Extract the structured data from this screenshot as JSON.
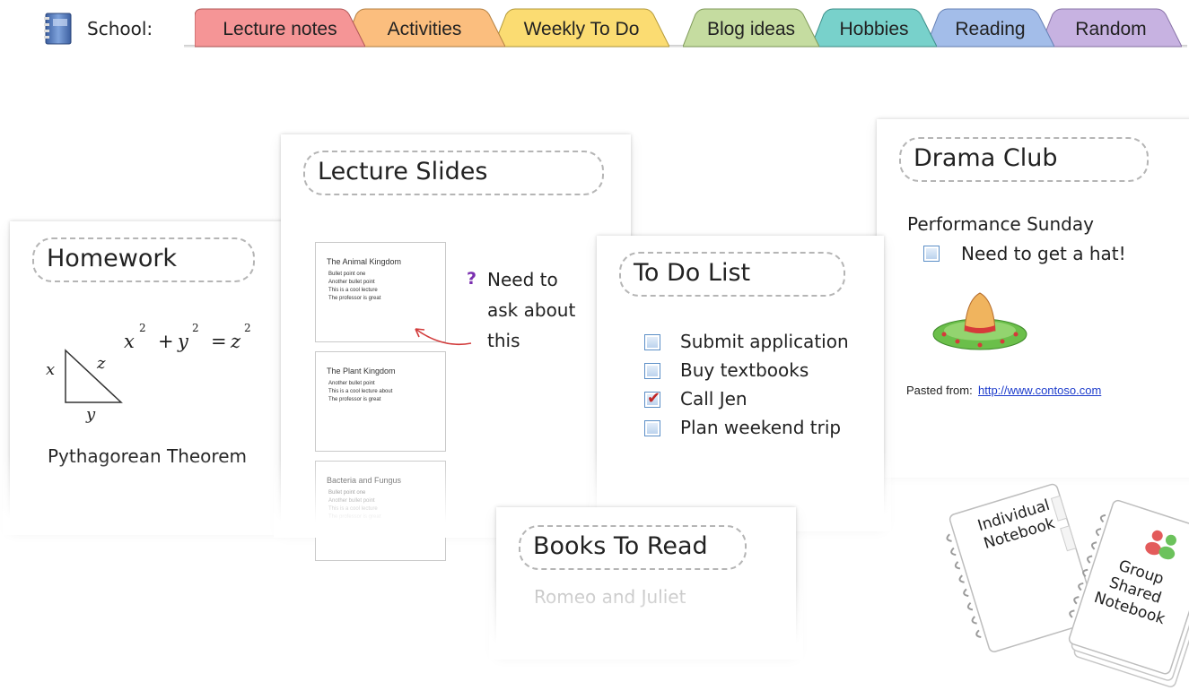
{
  "section_label": "School:",
  "tabs": [
    {
      "label": "Lecture notes",
      "color": "#f59596"
    },
    {
      "label": "Activities",
      "color": "#fbbe7e"
    },
    {
      "label": "Weekly To Do",
      "color": "#fbdc72"
    },
    {
      "label": "Blog ideas",
      "color": "#c5dca0"
    },
    {
      "label": "Hobbies",
      "color": "#78d1cb"
    },
    {
      "label": "Reading",
      "color": "#a3bde9"
    },
    {
      "label": "Random",
      "color": "#c7b2e1"
    }
  ],
  "homework": {
    "title": "Homework",
    "equation": {
      "x": "x",
      "y": "y",
      "z": "z",
      "exp": "2",
      "plus": "+",
      "equals": "="
    },
    "triangle_labels": {
      "x": "x",
      "y": "y",
      "z": "z"
    },
    "caption": "Pythagorean Theorem"
  },
  "lecture_slides": {
    "title": "Lecture Slides",
    "slides": [
      {
        "title": "The Animal Kingdom",
        "bullets": [
          "Bullet point one",
          "Another bullet point",
          "This is a cool lecture",
          "The professor is great"
        ]
      },
      {
        "title": "The Plant Kingdom",
        "bullets": [
          "Another bullet point",
          "This is a cool lecture about",
          "The professor is great"
        ]
      },
      {
        "title": "Bacteria and Fungus",
        "bullets": [
          "Bullet point one",
          "Another bullet point",
          "This is a cool lecture",
          "The professor is great"
        ]
      }
    ],
    "question_mark": "?",
    "question_lines": [
      "Need to",
      "ask about",
      "this"
    ]
  },
  "todo": {
    "title": "To Do List",
    "items": [
      {
        "label": "Submit application",
        "checked": false
      },
      {
        "label": "Buy textbooks",
        "checked": false
      },
      {
        "label": "Call Jen",
        "checked": true
      },
      {
        "label": "Plan weekend trip",
        "checked": false
      }
    ],
    "check_glyph": "✔"
  },
  "books": {
    "title": "Books To Read",
    "first_item": "Romeo and Juliet"
  },
  "drama": {
    "title": "Drama Club",
    "subtitle": "Performance Sunday",
    "item": "Need to get a hat!",
    "pasted_prefix": "Pasted from:",
    "pasted_link": "http://www.contoso.com"
  },
  "notebooks": {
    "individual": [
      "Individual",
      "Notebook"
    ],
    "group": [
      "Group",
      "Shared",
      "Notebook"
    ]
  }
}
